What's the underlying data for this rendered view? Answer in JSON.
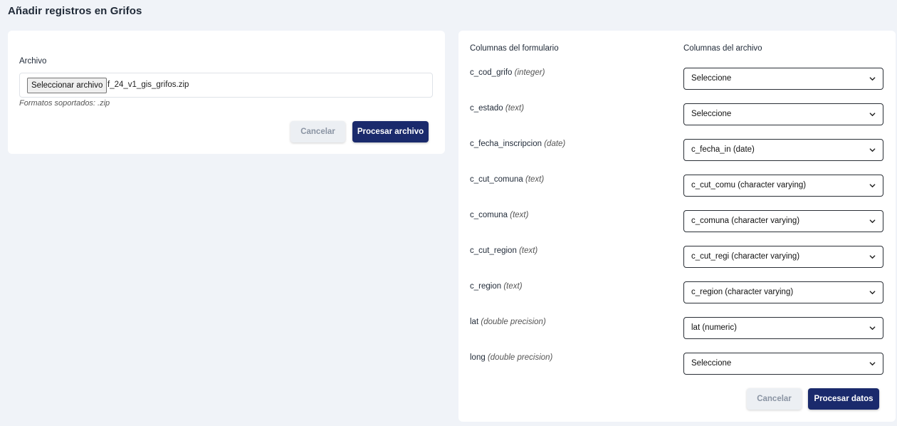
{
  "page": {
    "title": "Añadir registros en Grifos"
  },
  "upload": {
    "label": "Archivo",
    "choose_button": "Seleccionar archivo",
    "file_name": "f_24_v1_gis_grifos.zip",
    "hint": "Formatos soportados: .zip",
    "cancel_label": "Cancelar",
    "process_label": "Procesar archivo"
  },
  "mapping": {
    "form_columns_header": "Columnas del formulario",
    "file_columns_header": "Columnas del archivo",
    "rows": [
      {
        "name": "c_cod_grifo",
        "type": "(integer)",
        "selected": "Seleccione"
      },
      {
        "name": "c_estado",
        "type": "(text)",
        "selected": "Seleccione"
      },
      {
        "name": "c_fecha_inscripcion",
        "type": "(date)",
        "selected": "c_fecha_in (date)"
      },
      {
        "name": "c_cut_comuna",
        "type": "(text)",
        "selected": "c_cut_comu (character varying)"
      },
      {
        "name": "c_comuna",
        "type": "(text)",
        "selected": "c_comuna (character varying)"
      },
      {
        "name": "c_cut_region",
        "type": "(text)",
        "selected": "c_cut_regi (character varying)"
      },
      {
        "name": "c_region",
        "type": "(text)",
        "selected": "c_region (character varying)"
      },
      {
        "name": "lat",
        "type": "(double precision)",
        "selected": "lat (numeric)"
      },
      {
        "name": "long",
        "type": "(double precision)",
        "selected": "Seleccione"
      }
    ],
    "cancel_label": "Cancelar",
    "process_label": "Procesar datos"
  }
}
